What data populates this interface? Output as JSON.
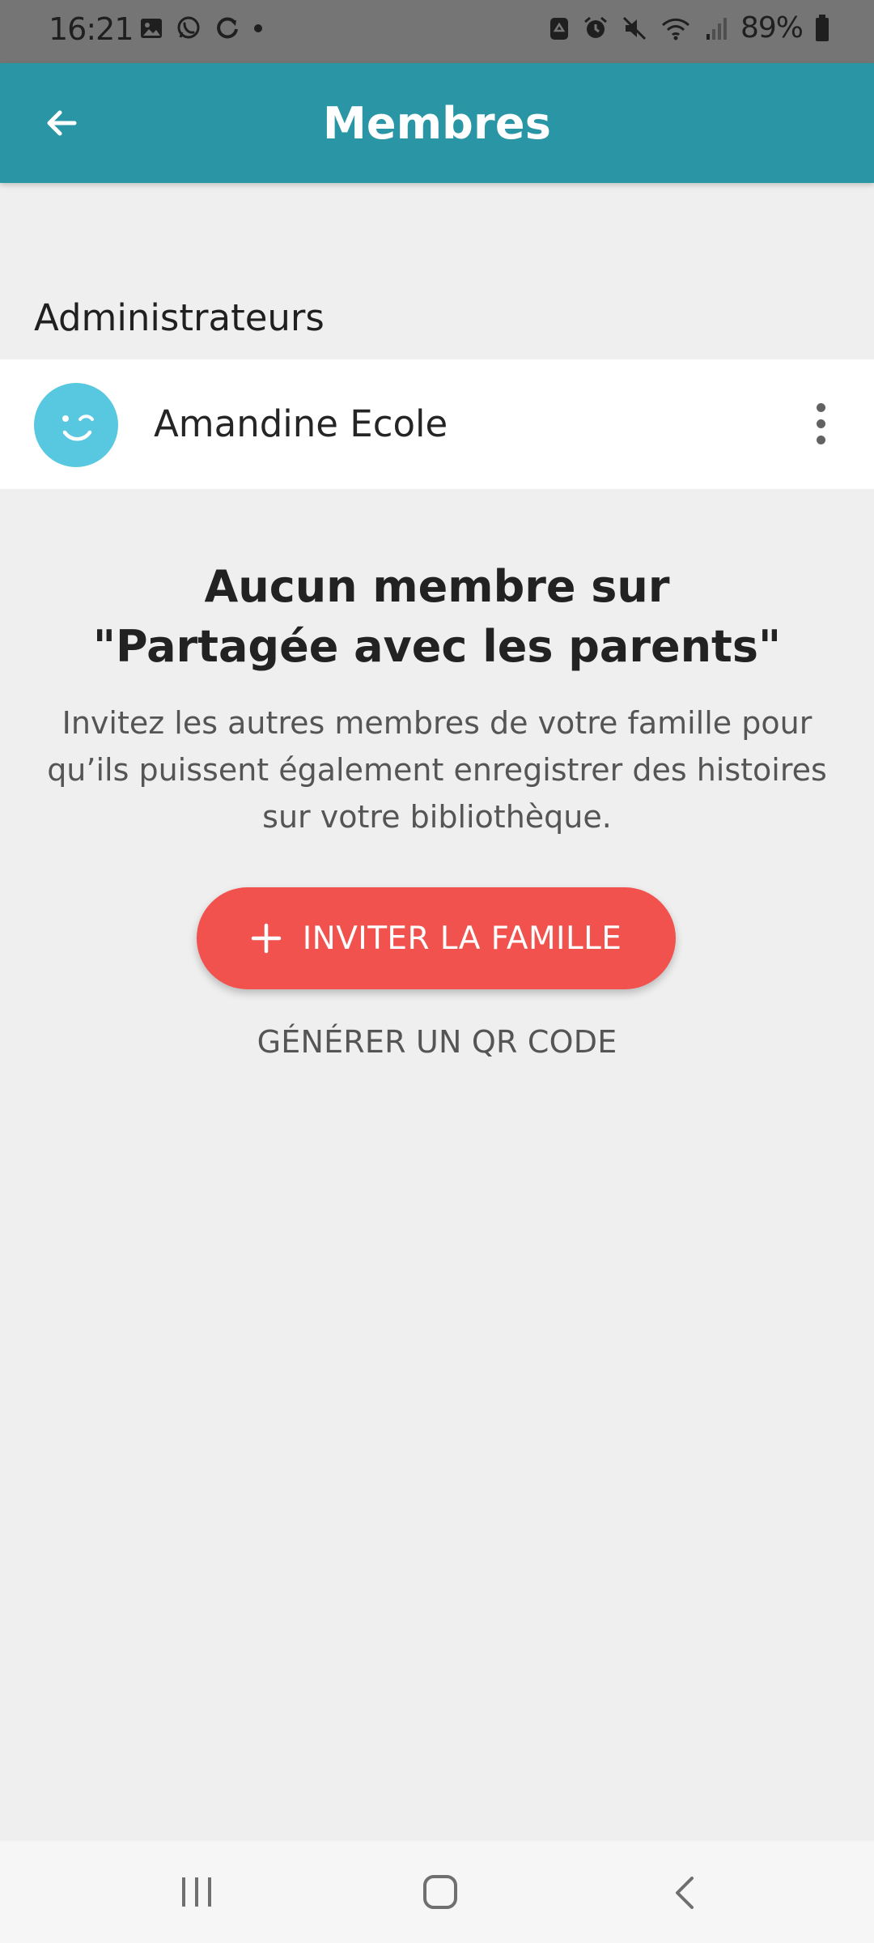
{
  "status_bar": {
    "time": "16:21",
    "battery_percent": "89%",
    "left_icons": [
      "gallery-icon",
      "whatsapp-icon",
      "sync-icon",
      "notification-dot-icon"
    ],
    "right_icons": [
      "recycle-icon",
      "alarm-icon",
      "mute-icon",
      "wifi-icon",
      "signal-icon",
      "battery-icon"
    ]
  },
  "app_bar": {
    "title": "Membres",
    "back_icon": "arrow-left-icon",
    "background_color": "#2a96a5"
  },
  "admins_section": {
    "label": "Administrateurs",
    "members": [
      {
        "name": "Amandine Ecole",
        "avatar_icon": "wink-face-icon",
        "avatar_color": "#57c8df",
        "more_icon": "more-vert-icon"
      }
    ]
  },
  "empty_state": {
    "title_line1": "Aucun membre sur",
    "title_line2": "\"Partagée avec les parents\"",
    "description": "Invitez les autres membres de votre famille pour qu’ils puissent également enregistrer des histoires sur votre bibliothèque."
  },
  "actions": {
    "invite_label": "INVITER LA FAMILLE",
    "invite_icon": "plus-icon",
    "invite_color": "#f2524d",
    "qr_label": "GÉNÉRER UN QR CODE"
  },
  "navigation": {
    "recents_icon": "recents-icon",
    "home_icon": "home-icon",
    "back_icon": "back-icon"
  }
}
